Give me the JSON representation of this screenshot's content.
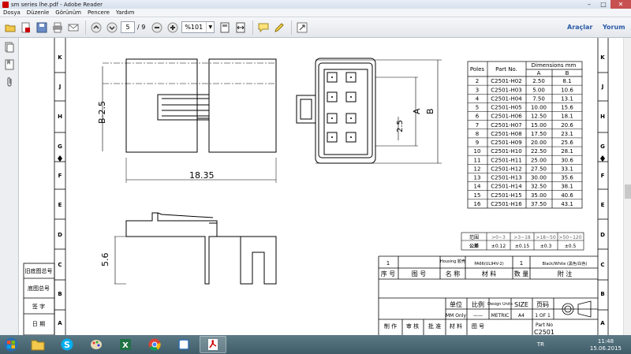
{
  "window": {
    "title": "sm series lhe.pdf - Adobe Reader"
  },
  "menu": [
    "Dosya",
    "Düzenle",
    "Görünüm",
    "Pencere",
    "Yardım"
  ],
  "toolbar": {
    "page_current": "5",
    "page_total": "/ 9",
    "zoom": "%101",
    "tools_label": "Araçlar",
    "comment_label": "Yorum"
  },
  "drawing": {
    "dim_side_height": "B-2.5",
    "dim_length": "18.35",
    "dim_pitch": "2.5",
    "dim_a": "A",
    "dim_b": "B",
    "dim_bottom_height": "5.6",
    "border_letters_right": [
      "K",
      "J",
      "H",
      "G",
      "F",
      "E",
      "D",
      "C",
      "B",
      "A"
    ],
    "border_letters_left": [
      "K",
      "J",
      "H",
      "G",
      "F",
      "E",
      "D",
      "C",
      "B",
      "A"
    ],
    "left_labels": [
      "旧底图总号",
      "底图总号",
      "签 字",
      "日 期"
    ]
  },
  "dimensions_table": {
    "headers": {
      "poles": "Poles",
      "part_no": "Part No.",
      "dims": "Dimensions mm",
      "a": "A",
      "b": "B"
    },
    "rows": [
      [
        "2",
        "C2501-H02",
        "2.50",
        "8.1"
      ],
      [
        "3",
        "C2501-H03",
        "5.00",
        "10.6"
      ],
      [
        "4",
        "C2501-H04",
        "7.50",
        "13.1"
      ],
      [
        "5",
        "C2501-H05",
        "10.00",
        "15.6"
      ],
      [
        "6",
        "C2501-H06",
        "12.50",
        "18.1"
      ],
      [
        "7",
        "C2501-H07",
        "15.00",
        "20.6"
      ],
      [
        "8",
        "C2501-H08",
        "17.50",
        "23.1"
      ],
      [
        "9",
        "C2501-H09",
        "20.00",
        "25.6"
      ],
      [
        "10",
        "C2501-H10",
        "22.50",
        "28.1"
      ],
      [
        "11",
        "C2501-H11",
        "25.00",
        "30.6"
      ],
      [
        "12",
        "C2501-H12",
        "27.50",
        "33.1"
      ],
      [
        "13",
        "C2501-H13",
        "30.00",
        "35.6"
      ],
      [
        "14",
        "C2501-H14",
        "32.50",
        "38.1"
      ],
      [
        "15",
        "C2501-H15",
        "35.00",
        "40.6"
      ],
      [
        "16",
        "C2501-H16",
        "37.50",
        "43.1"
      ]
    ]
  },
  "tolerance_table": {
    "headers": [
      "范围",
      ">0~3",
      ">3~18",
      ">18~50",
      ">50~120"
    ],
    "row": [
      "公差",
      "±0.12",
      "±0.15",
      "±0.3",
      "±0.5"
    ]
  },
  "title_block": {
    "item_row": [
      "1",
      "",
      "Housing 胶壳",
      "PA66(UL94V-2)",
      "1",
      "Black/White (黑色/白色)"
    ],
    "header_row": [
      "序 号",
      "图 号",
      "名 称",
      "材 料",
      "数 量",
      "附 注"
    ],
    "unit_labels": [
      "单位",
      "比例",
      "Design Units",
      "SIZE",
      "页码"
    ],
    "unit_values": [
      "MM Only",
      "——",
      "METRIC",
      "A4",
      "1 OF 1"
    ],
    "sign_row": [
      "制 作",
      "审 核",
      "批 准",
      "材 料",
      "图 号",
      "Part No"
    ],
    "part_no": "C2501"
  },
  "taskbar": {
    "lang": "TR",
    "time": "11:48",
    "date": "15.06.2015"
  }
}
